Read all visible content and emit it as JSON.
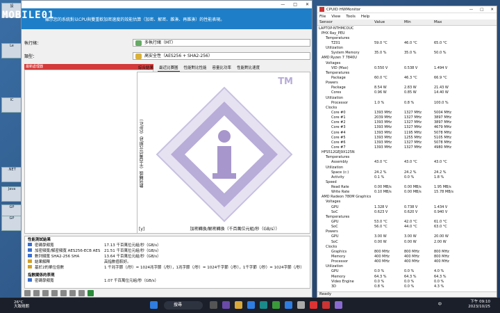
{
  "desktop": {
    "icons": [
      "設",
      "Le",
      "IC",
      ".NET",
      "Java",
      "GP",
      "GP"
    ]
  },
  "left_window": {
    "title_controls": [
      "—",
      "□",
      "✕"
    ],
    "logo": "MOBILE01",
    "banner_text": "顯示您的系統對以CPU與雙重軟加密速度的效能估算（加密、解密、雜湊、再雜湊）的性能表現。",
    "thread_label": "執行緒：",
    "thread_value": "多執行緒（MT）",
    "algo_label": "類型：",
    "algo_value": "高安全性（AES256 + SHA2-256）",
    "list_header": "最新處理器",
    "tabs": [
      "綜合結果",
      "最近比賽圖",
      "性能對比性能",
      "容量比功率",
      "性能對比速度"
    ],
    "chart_ylabel": "數列轉換（千百萬位元組/秒（GB/s））",
    "chart_xlabel": "加密轉換/解密轉換（千百萬位元組/秒（GB/s））",
    "chart_ymark": "[y]",
    "tm_mark": "TM",
    "results_header": "性能測試結果",
    "results": [
      {
        "k": "密碼學頻寬",
        "v": "17.13 千百萬位元組/秒（GB/s）"
      },
      {
        "k": "加密頻寬/解密頻寬 AES256-ECB AES",
        "v": "21.51 千百萬位元組/秒（GB/s）"
      },
      {
        "k": "數列頻寬 SHA2-256 SHA",
        "v": "13.64 千百萬位元組/秒（GB/s）"
      },
      {
        "k": "結果解釋",
        "v": "高指數值較好。"
      },
      {
        "k": "基於2的單位倍數",
        "v": "1 千兆字節（/秒）= 1024兆字節（/秒），1兆字節（/秒）= 1024千字節（/秒），1千字節（/秒）= 1024字節（/秒）"
      }
    ],
    "results2_header": "指數關係的表現",
    "results2": [
      {
        "k": "密碼學頻寬",
        "v": "1.07 千百萬位元組/秒（GB/s）"
      }
    ]
  },
  "hwmonitor": {
    "title": "CPUID HWMonitor",
    "controls": [
      "—",
      "□",
      "✕"
    ],
    "menu": [
      "File",
      "View",
      "Tools",
      "Help"
    ],
    "columns": [
      "Sensor",
      "Value",
      "Min",
      "Max"
    ],
    "rows": [
      [
        "LAPTOP-NTHMCOUC",
        "",
        "",
        ""
      ],
      [
        "PHX Ray_PEU",
        "",
        "",
        ""
      ],
      [
        "Temperatures",
        "",
        "",
        ""
      ],
      [
        "TZ01",
        "59.0 °C",
        "46.0 °C",
        "65.0 °C"
      ],
      [
        "Utilization",
        "",
        "",
        ""
      ],
      [
        "System Memory",
        "35.0 %",
        "35.0 %",
        "50.0 %"
      ],
      [
        "AMD Ryzen 7 7840U",
        "",
        "",
        ""
      ],
      [
        "Voltages",
        "",
        "",
        ""
      ],
      [
        "VID (Max)",
        "0.550 V",
        "0.538 V",
        "1.494 V"
      ],
      [
        "Temperatures",
        "",
        "",
        ""
      ],
      [
        "Package",
        "60.0 °C",
        "46.3 °C",
        "66.9 °C"
      ],
      [
        "Powers",
        "",
        "",
        ""
      ],
      [
        "Package",
        "8.54 W",
        "2.83 W",
        "21.43 W"
      ],
      [
        "Cores",
        "0.96 W",
        "0.85 W",
        "14.40 W"
      ],
      [
        "Utilization",
        "",
        "",
        ""
      ],
      [
        "Processor",
        "1.0 %",
        "0.8 %",
        "100.0 %"
      ],
      [
        "Clocks",
        "",
        "",
        ""
      ],
      [
        "Core #0",
        "1393 MHz",
        "1327 MHz",
        "5004 MHz"
      ],
      [
        "Core #1",
        "2039 MHz",
        "1327 MHz",
        "3897 MHz"
      ],
      [
        "Core #2",
        "1393 MHz",
        "1327 MHz",
        "3897 MHz"
      ],
      [
        "Core #3",
        "1393 MHz",
        "1327 MHz",
        "4679 MHz"
      ],
      [
        "Core #4",
        "1393 MHz",
        "1195 MHz",
        "5078 MHz"
      ],
      [
        "Core #5",
        "1393 MHz",
        "1255 MHz",
        "5105 MHz"
      ],
      [
        "Core #6",
        "1393 MHz",
        "1327 MHz",
        "5078 MHz"
      ],
      [
        "Core #7",
        "1393 MHz",
        "1327 MHz",
        "4980 MHz"
      ],
      [
        "HFS512GEJ9X125N",
        "",
        "",
        ""
      ],
      [
        "Temperatures",
        "",
        "",
        ""
      ],
      [
        "Assembly",
        "43.0 °C",
        "43.0 °C",
        "43.0 °C"
      ],
      [
        "Utilization",
        "",
        "",
        ""
      ],
      [
        "Space (c:)",
        "24.2 %",
        "24.2 %",
        "24.2 %"
      ],
      [
        "Activity",
        "0.1 %",
        "0.0 %",
        "1.8 %"
      ],
      [
        "Speed",
        "",
        "",
        ""
      ],
      [
        "Read Rate",
        "0.00 MB/s",
        "0.00 MB/s",
        "1.95 MB/s"
      ],
      [
        "Write Rate",
        "0.10 MB/s",
        "0.00 MB/s",
        "15.78 MB/s"
      ],
      [
        "AMD Radeon 780M Graphics",
        "",
        "",
        ""
      ],
      [
        "Voltages",
        "",
        "",
        ""
      ],
      [
        "GPU",
        "1.328 V",
        "0.738 V",
        "1.434 V"
      ],
      [
        "SoC",
        "0.623 V",
        "0.620 V",
        "0.940 V"
      ],
      [
        "Temperatures",
        "",
        "",
        ""
      ],
      [
        "GPU",
        "53.0 °C",
        "42.0 °C",
        "61.0 °C"
      ],
      [
        "SoC",
        "56.0 °C",
        "44.0 °C",
        "63.0 °C"
      ],
      [
        "Powers",
        "",
        "",
        ""
      ],
      [
        "GPU",
        "3.00 W",
        "3.00 W",
        "20.00 W"
      ],
      [
        "SoC",
        "0.00 W",
        "0.00 W",
        "2.00 W"
      ],
      [
        "Clocks",
        "",
        "",
        ""
      ],
      [
        "Graphics",
        "800 MHz",
        "800 MHz",
        "800 MHz"
      ],
      [
        "Memory",
        "400 MHz",
        "400 MHz",
        "800 MHz"
      ],
      [
        "Processor",
        "400 MHz",
        "400 MHz",
        "400 MHz"
      ],
      [
        "Utilization",
        "",
        "",
        ""
      ],
      [
        "GPU",
        "0.0 %",
        "0.0 %",
        "4.0 %"
      ],
      [
        "Memory",
        "64.3 %",
        "64.3 %",
        "64.3 %"
      ],
      [
        "Video Engine",
        "0.0 %",
        "0.0 %",
        "0.0 %"
      ],
      [
        "3D",
        "0.8 %",
        "0.0 %",
        "4.3 %"
      ]
    ],
    "status": "Ready"
  },
  "taskbar": {
    "weather_temp": "26°C",
    "weather_desc": "大致晴朗",
    "search_placeholder": "搜尋",
    "lang": "中",
    "time": "下午 09:10",
    "date": "2023/10/25"
  }
}
